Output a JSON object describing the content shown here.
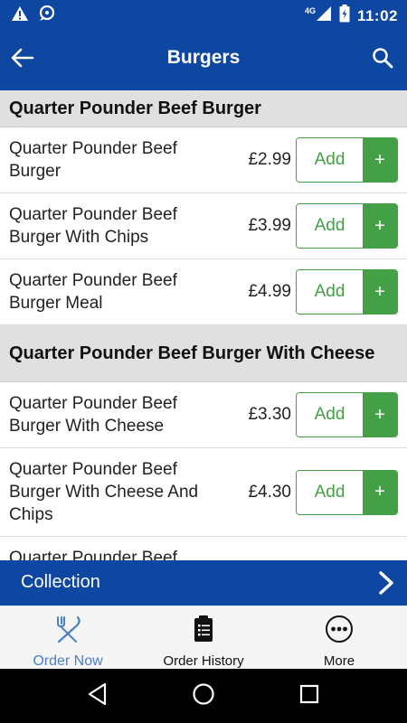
{
  "status_bar": {
    "time": "11:02",
    "network": "4G",
    "icons": [
      "warning-icon",
      "notification-icon",
      "signal-icon",
      "battery-icon"
    ]
  },
  "app_bar": {
    "title": "Burgers",
    "back_icon": "back-arrow-icon",
    "search_icon": "search-icon"
  },
  "sections": [
    {
      "title": "Quarter Pounder Beef Burger",
      "items": [
        {
          "name": "Quarter Pounder Beef Burger",
          "price": "£2.99",
          "add_label": "Add",
          "plus": "+"
        },
        {
          "name": "Quarter Pounder Beef Burger With Chips",
          "price": "£3.99",
          "add_label": "Add",
          "plus": "+"
        },
        {
          "name": "Quarter Pounder Beef Burger Meal",
          "price": "£4.99",
          "add_label": "Add",
          "plus": "+"
        }
      ]
    },
    {
      "title": "Quarter Pounder Beef Burger With Cheese",
      "items": [
        {
          "name": "Quarter Pounder Beef Burger With Cheese",
          "price": "£3.30",
          "add_label": "Add",
          "plus": "+"
        },
        {
          "name": "Quarter Pounder Beef Burger With Cheese And Chips",
          "price": "£4.30",
          "add_label": "Add",
          "plus": "+"
        },
        {
          "name": "Quarter Pounder Beef",
          "price": "",
          "add_label": "",
          "plus": ""
        }
      ]
    }
  ],
  "collection_bar": {
    "label": "Collection",
    "icon": "chevron-right-icon"
  },
  "bottom_nav": [
    {
      "label": "Order Now",
      "icon": "fork-knife-icon",
      "active": true
    },
    {
      "label": "Order History",
      "icon": "clipboard-icon",
      "active": false
    },
    {
      "label": "More",
      "icon": "more-dots-icon",
      "active": false
    }
  ],
  "colors": {
    "primary": "#0d47a1",
    "accent_green": "#43a047",
    "active_tab": "#4a80c5",
    "section_bg": "#e0e0e0"
  }
}
